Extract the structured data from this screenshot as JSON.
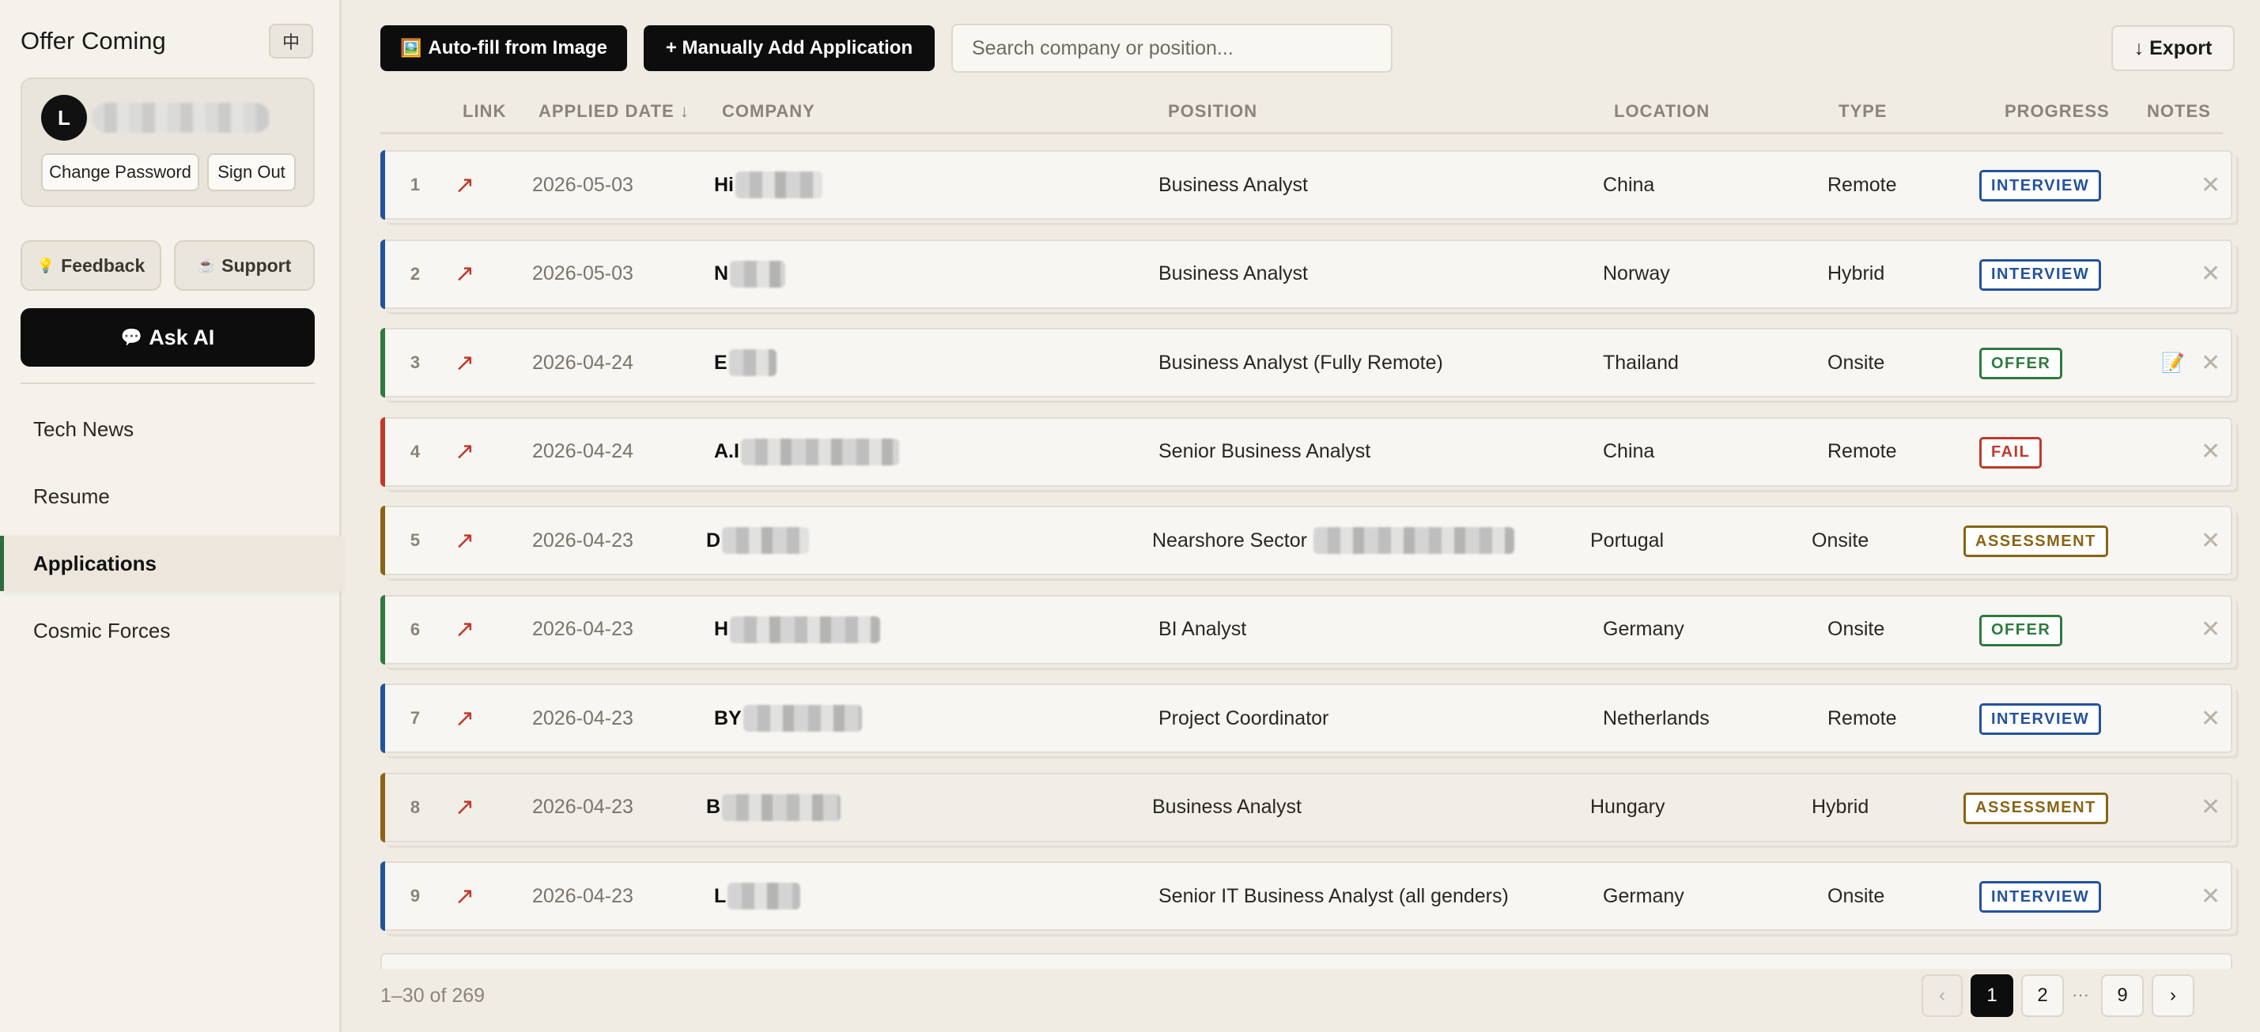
{
  "sidebar": {
    "title": "Offer Coming",
    "lang_toggle": "中",
    "user": {
      "avatar_initial": "L"
    },
    "change_password": "Change Password",
    "sign_out": "Sign Out",
    "feedback": {
      "icon": "💡",
      "label": "Feedback"
    },
    "support": {
      "icon": "☕",
      "label": "Support"
    },
    "ask_ai": {
      "icon": "💬",
      "label": "Ask AI"
    },
    "nav": [
      {
        "label": "Tech News",
        "active": false
      },
      {
        "label": "Resume",
        "active": false
      },
      {
        "label": "Applications",
        "active": true
      },
      {
        "label": "Cosmic Forces",
        "active": false
      }
    ]
  },
  "toolbar": {
    "autofill": {
      "icon": "🖼️",
      "label": "Auto-fill from Image"
    },
    "manual_add": "+ Manually Add Application",
    "search_placeholder": "Search company or position...",
    "export": "↓ Export"
  },
  "table": {
    "headers": {
      "link": "LINK",
      "applied_date": "APPLIED DATE ↓",
      "company": "COMPANY",
      "position": "POSITION",
      "location": "LOCATION",
      "type": "TYPE",
      "progress": "PROGRESS",
      "notes": "NOTES"
    },
    "link_icon": "↗",
    "delete_icon": "✕",
    "rows": [
      {
        "num": "1",
        "date": "2026-05-03",
        "company_prefix": "Hi",
        "position": "Business Analyst",
        "location": "China",
        "type": "Remote",
        "progress": "INTERVIEW",
        "status": "interview",
        "note": ""
      },
      {
        "num": "2",
        "date": "2026-05-03",
        "company_prefix": "N",
        "position": "Business Analyst",
        "location": "Norway",
        "type": "Hybrid",
        "progress": "INTERVIEW",
        "status": "interview",
        "note": ""
      },
      {
        "num": "3",
        "date": "2026-04-24",
        "company_prefix": "E",
        "position": "Business Analyst (Fully Remote)",
        "location": "Thailand",
        "type": "Onsite",
        "progress": "OFFER",
        "status": "offer",
        "note": "📝"
      },
      {
        "num": "4",
        "date": "2026-04-24",
        "company_prefix": "A.I",
        "position": "Senior Business Analyst",
        "location": "China",
        "type": "Remote",
        "progress": "FAIL",
        "status": "fail",
        "note": ""
      },
      {
        "num": "5",
        "date": "2026-04-23",
        "company_prefix": "D",
        "position": "Nearshore Sector",
        "location": "Portugal",
        "type": "Onsite",
        "progress": "ASSESSMENT",
        "status": "assessment",
        "note": ""
      },
      {
        "num": "6",
        "date": "2026-04-23",
        "company_prefix": "H",
        "position": "BI Analyst",
        "location": "Germany",
        "type": "Onsite",
        "progress": "OFFER",
        "status": "offer",
        "note": ""
      },
      {
        "num": "7",
        "date": "2026-04-23",
        "company_prefix": "BY",
        "position": "Project Coordinator",
        "location": "Netherlands",
        "type": "Remote",
        "progress": "INTERVIEW",
        "status": "interview",
        "note": ""
      },
      {
        "num": "8",
        "date": "2026-04-23",
        "company_prefix": "B",
        "position": "Business Analyst",
        "location": "Hungary",
        "type": "Hybrid",
        "progress": "ASSESSMENT",
        "status": "assessment",
        "note": ""
      },
      {
        "num": "9",
        "date": "2026-04-23",
        "company_prefix": "L",
        "position": "Senior IT Business Analyst (all genders)",
        "location": "Germany",
        "type": "Onsite",
        "progress": "INTERVIEW",
        "status": "interview",
        "note": ""
      }
    ]
  },
  "pagination": {
    "summary": "1–30 of 269",
    "prev": "‹",
    "pages": [
      "1",
      "2"
    ],
    "ellipsis": "···",
    "last": "9",
    "next": "›",
    "current": "1"
  },
  "colors": {
    "interview": "#24539b",
    "offer": "#2f7a3f",
    "fail": "#c0392b",
    "assessment": "#8a6414"
  }
}
